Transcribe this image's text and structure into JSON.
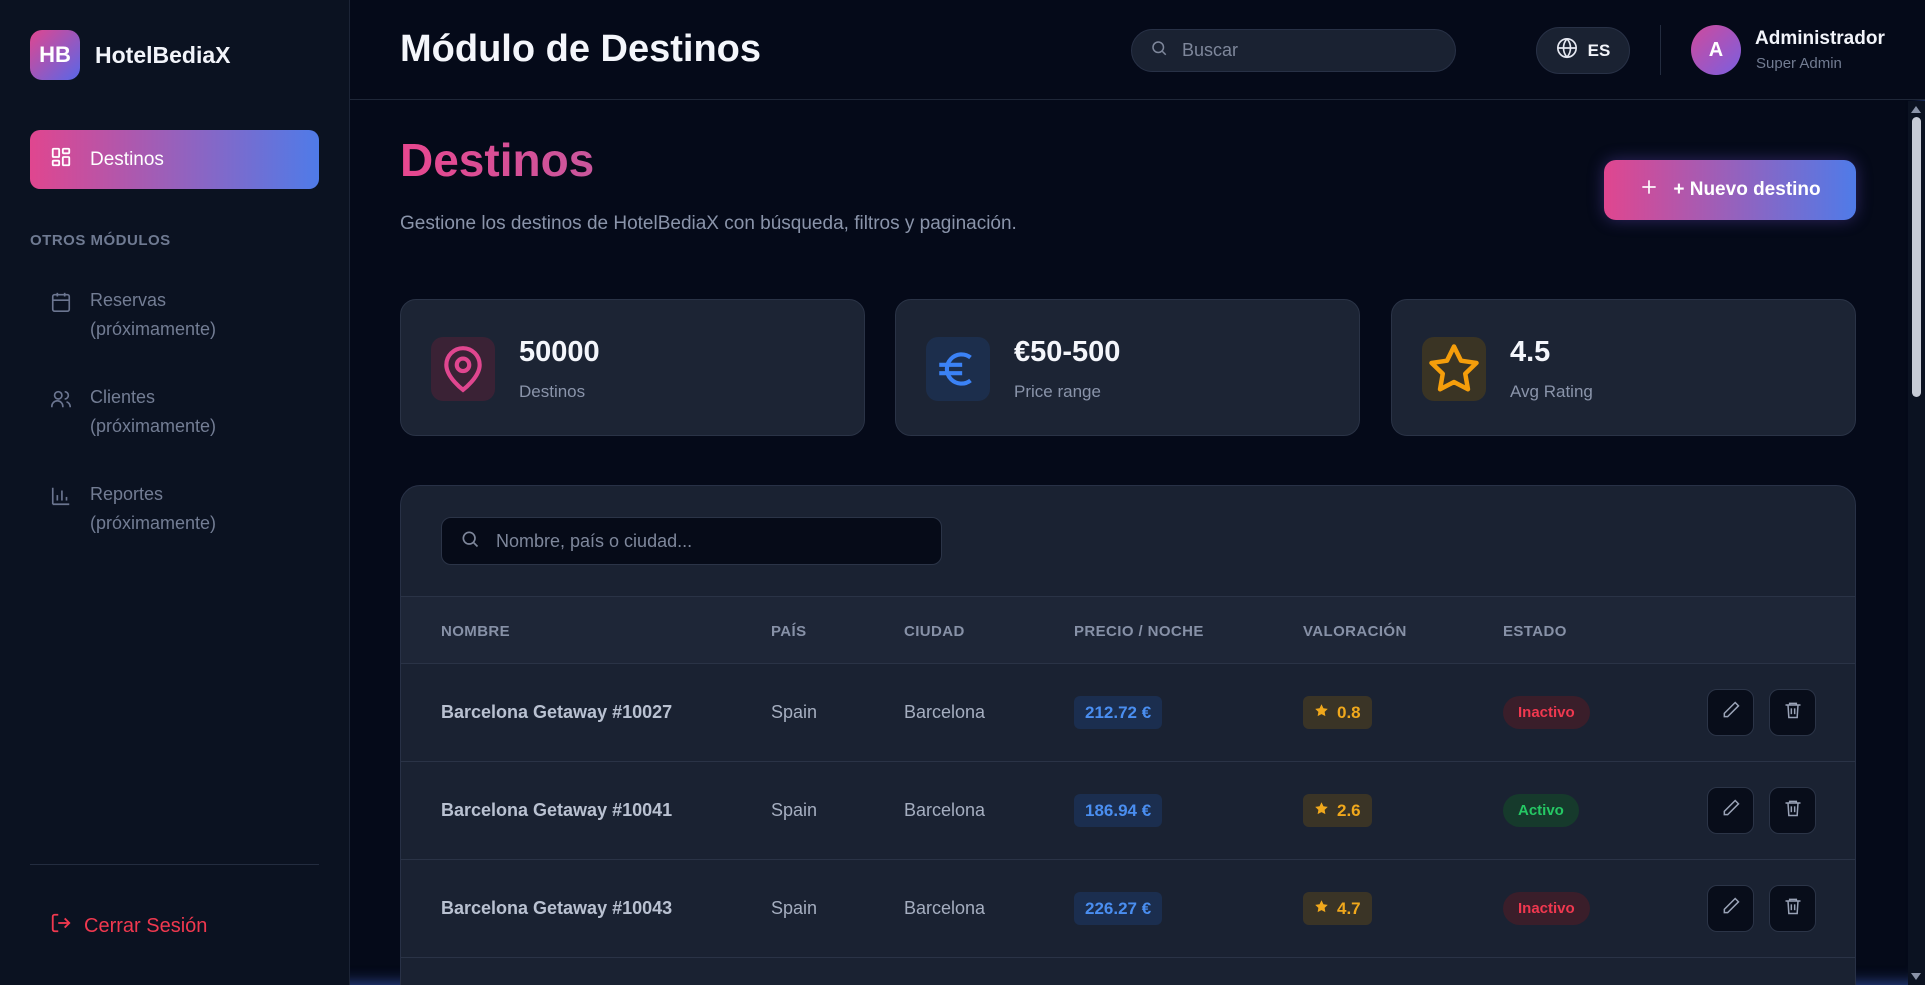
{
  "brand": {
    "logo": "HB",
    "name": "HotelBediaX"
  },
  "sidebar": {
    "active_item": {
      "label": "Destinos",
      "icon": "dashboard-grid-icon"
    },
    "section_label": "OTROS MÓDULOS",
    "items": [
      {
        "line1": "Reservas",
        "line2": "(próximamente)",
        "icon": "calendar-icon"
      },
      {
        "line1": "Clientes",
        "line2": "(próximamente)",
        "icon": "users-icon"
      },
      {
        "line1": "Reportes",
        "line2": "(próximamente)",
        "icon": "bar-chart-icon"
      }
    ],
    "logout_label": "Cerrar Sesión"
  },
  "header": {
    "title": "Módulo de Destinos",
    "search_placeholder": "Buscar",
    "language": "ES",
    "avatar_initial": "A",
    "user_name": "Administrador",
    "user_role": "Super Admin"
  },
  "main": {
    "title": "Destinos",
    "subtitle": "Gestione los destinos de HotelBediaX con búsqueda, filtros y paginación.",
    "new_button_label": "+ Nuevo destino",
    "stats": [
      {
        "value": "50000",
        "label": "Destinos",
        "icon": "map-pin-icon",
        "color": "#e0468f"
      },
      {
        "value": "€50-500",
        "label": "Price range",
        "icon": "euro-icon",
        "color": "#3b82f6"
      },
      {
        "value": "4.5",
        "label": "Avg Rating",
        "icon": "star-icon",
        "color": "#f59e0b"
      }
    ],
    "table": {
      "search_placeholder": "Nombre, país o ciudad...",
      "headers": [
        "NOMBRE",
        "PAÍS",
        "CIUDAD",
        "PRECIO / NOCHE",
        "VALORACIÓN",
        "ESTADO"
      ],
      "rows": [
        {
          "name": "Barcelona Getaway #10027",
          "country": "Spain",
          "city": "Barcelona",
          "price": "212.72 €",
          "rating": "0.8",
          "status": "Inactivo"
        },
        {
          "name": "Barcelona Getaway #10041",
          "country": "Spain",
          "city": "Barcelona",
          "price": "186.94 €",
          "rating": "2.6",
          "status": "Activo"
        },
        {
          "name": "Barcelona Getaway #10043",
          "country": "Spain",
          "city": "Barcelona",
          "price": "226.27 €",
          "rating": "4.7",
          "status": "Inactivo"
        }
      ]
    }
  },
  "colors": {
    "accent_pink": "#e0468f",
    "accent_blue": "#4f7be8",
    "status_active": "#25c864",
    "status_inactive": "#f0384f"
  }
}
